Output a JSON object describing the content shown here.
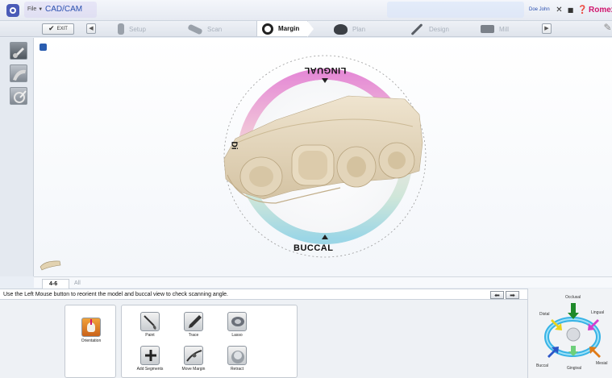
{
  "titlebar": {
    "file_menu": "File",
    "app_title": "CAD/CAM",
    "user_name": "Doe John",
    "brand": "Romexis"
  },
  "workflow": {
    "exit_label": "EXIT",
    "steps": [
      {
        "label": "Setup",
        "state": "disabled"
      },
      {
        "label": "Scan",
        "state": "disabled"
      },
      {
        "label": "Margin",
        "state": "active"
      },
      {
        "label": "Plan",
        "state": "disabled"
      },
      {
        "label": "Design",
        "state": "disabled"
      },
      {
        "label": "Mill",
        "state": "disabled"
      }
    ]
  },
  "viewport": {
    "orientation_labels": {
      "lingual": "LINGUAL",
      "buccal": "BUCCAL",
      "distal": "Di"
    }
  },
  "tabs": [
    {
      "label": "4-6",
      "selected": true
    },
    {
      "label": "All",
      "selected": false
    }
  ],
  "status": {
    "message": "Use the Left Mouse button to reorient the model and buccal view to check scanning angle."
  },
  "tools": {
    "orientation": "Orientation",
    "paint": "Paint",
    "trace": "Trace",
    "lasso": "Lasso",
    "add_segments": "Add Segments",
    "move_margin": "Move Margin",
    "retract": "Retract"
  },
  "orientation_widget": {
    "occlusal": "Occlusal",
    "distal": "Distal",
    "lingual": "Lingual",
    "buccal": "Buccal",
    "gingival": "Gingival",
    "mesial": "Mesial"
  },
  "colors": {
    "brand": "#d0166e",
    "title_blue": "#2a4fb0",
    "ring_top": "#e58bd6",
    "ring_bottom": "#9bd6e6",
    "tooth": "#e6d7bd"
  }
}
